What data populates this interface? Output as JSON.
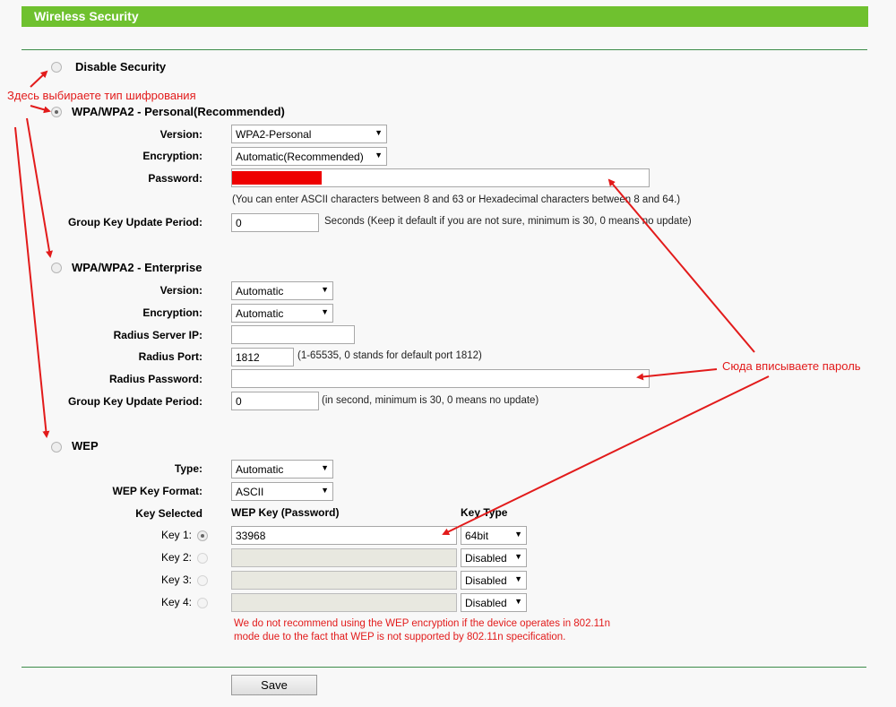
{
  "title": "Wireless Security",
  "disable": {
    "label": "Disable Security"
  },
  "personal": {
    "label": "WPA/WPA2 - Personal(Recommended)",
    "version_label": "Version:",
    "version_value": "WPA2-Personal",
    "encryption_label": "Encryption:",
    "encryption_value": "Automatic(Recommended)",
    "password_label": "Password:",
    "password_hint": "(You can enter ASCII characters between 8 and 63 or Hexadecimal characters between 8 and 64.)",
    "gkup_label": "Group Key Update Period:",
    "gkup_value": "0",
    "gkup_hint": "Seconds (Keep it default if you are not sure, minimum is 30, 0 means no update)"
  },
  "enterprise": {
    "label": "WPA/WPA2 - Enterprise",
    "version_label": "Version:",
    "version_value": "Automatic",
    "encryption_label": "Encryption:",
    "encryption_value": "Automatic",
    "radius_ip_label": "Radius Server IP:",
    "radius_ip_value": "",
    "radius_port_label": "Radius Port:",
    "radius_port_value": "1812",
    "radius_port_hint": "(1-65535, 0 stands for default port 1812)",
    "radius_pw_label": "Radius Password:",
    "radius_pw_value": "",
    "gkup_label": "Group Key Update Period:",
    "gkup_value": "0",
    "gkup_hint": "(in second, minimum is 30, 0 means no update)"
  },
  "wep": {
    "label": "WEP",
    "type_label": "Type:",
    "type_value": "Automatic",
    "format_label": "WEP Key Format:",
    "format_value": "ASCII",
    "col_selected": "Key Selected",
    "col_key": "WEP Key (Password)",
    "col_type": "Key Type",
    "keys": [
      {
        "label": "Key 1:",
        "value": "33968",
        "type": "64bit"
      },
      {
        "label": "Key 2:",
        "value": "",
        "type": "Disabled"
      },
      {
        "label": "Key 3:",
        "value": "",
        "type": "Disabled"
      },
      {
        "label": "Key 4:",
        "value": "",
        "type": "Disabled"
      }
    ],
    "warning": "We do not recommend using the WEP encryption if the device operates in 802.11n mode due to the fact that WEP is not supported by 802.11n specification."
  },
  "annotations": {
    "select_type": "Здесь выбираете тип шифрования",
    "enter_password": "Сюда вписываете пароль"
  },
  "save_label": "Save",
  "colors": {
    "header_green": "#6fc12f",
    "annotation_red": "#e21b1b",
    "divider_green": "#3d8c4a"
  }
}
